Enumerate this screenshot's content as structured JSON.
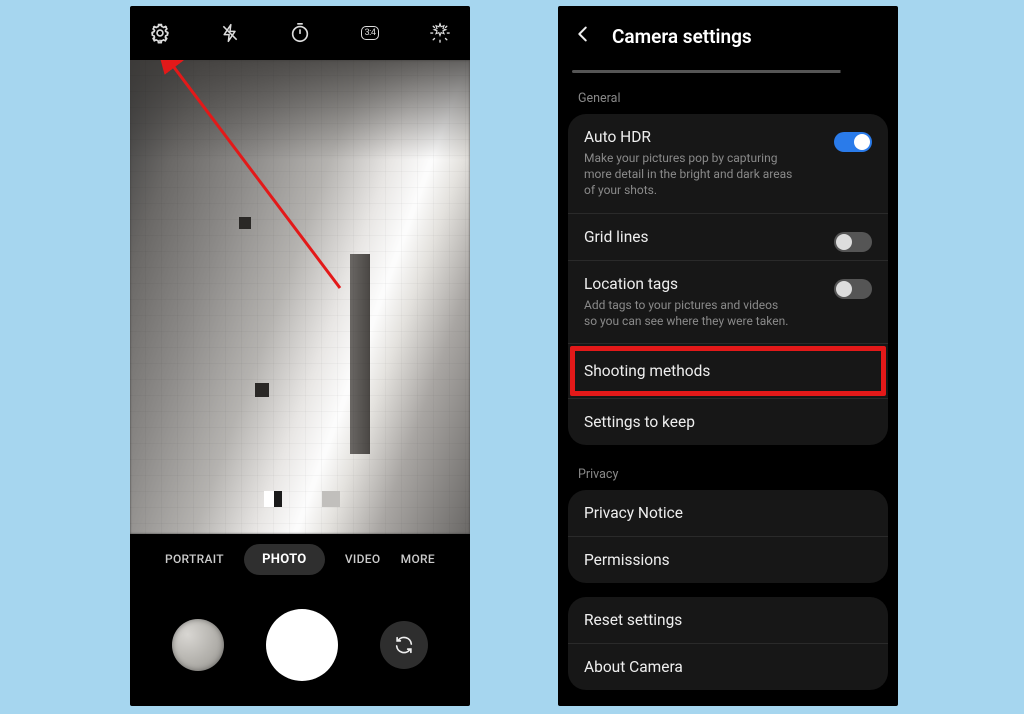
{
  "left": {
    "toolbar": {
      "ratio_label": "3:4"
    },
    "modes": {
      "portrait": "PORTRAIT",
      "photo": "PHOTO",
      "video": "VIDEO",
      "more": "MORE"
    }
  },
  "right": {
    "title": "Camera settings",
    "sections": {
      "general_label": "General",
      "privacy_label": "Privacy"
    },
    "rows": {
      "auto_hdr_title": "Auto HDR",
      "auto_hdr_desc": "Make your pictures pop by capturing more detail in the bright and dark areas of your shots.",
      "grid_title": "Grid lines",
      "location_title": "Location tags",
      "location_desc": "Add tags to your pictures and videos so you can see where they were taken.",
      "shooting_title": "Shooting methods",
      "settings_keep_title": "Settings to keep",
      "privacy_notice_title": "Privacy Notice",
      "permissions_title": "Permissions",
      "reset_title": "Reset settings",
      "about_title": "About Camera"
    }
  }
}
